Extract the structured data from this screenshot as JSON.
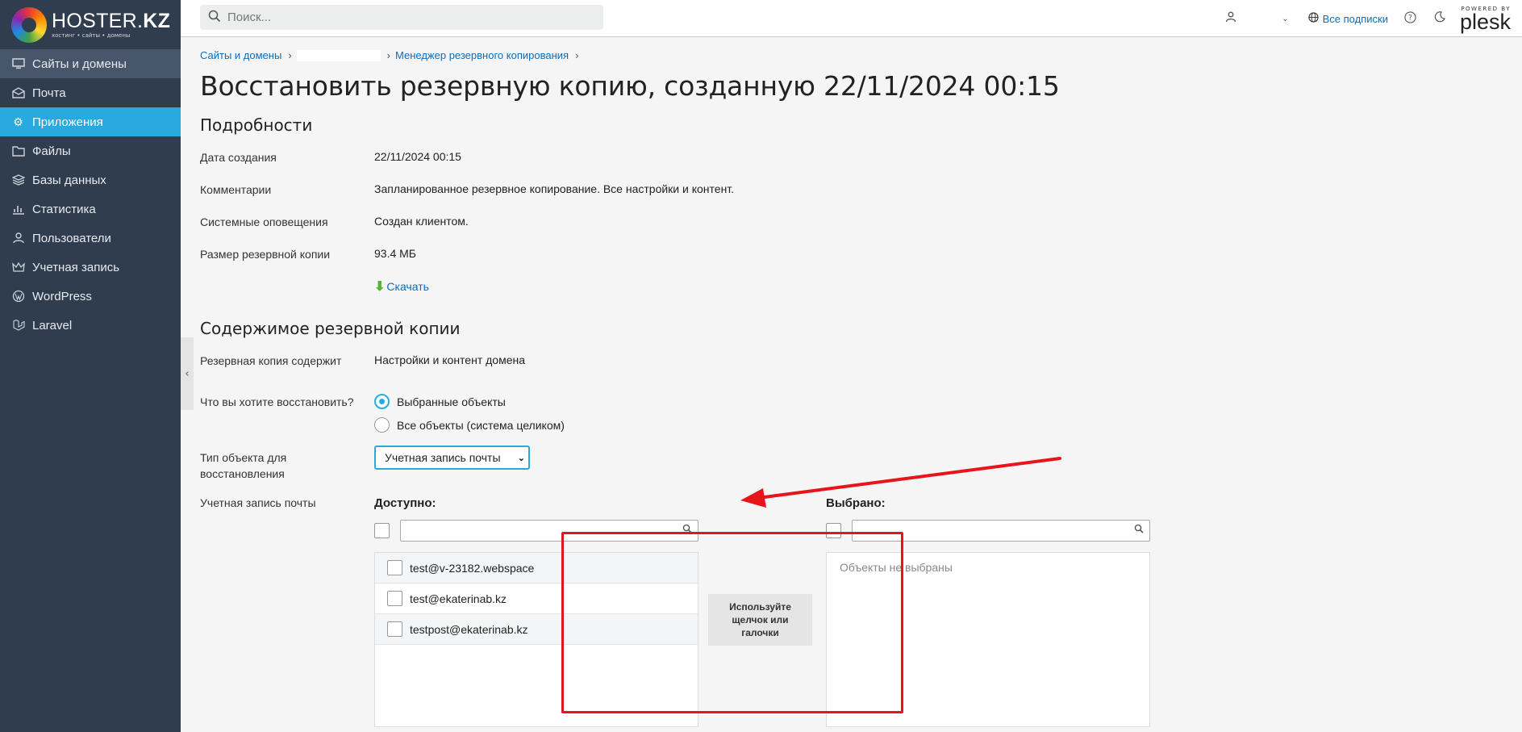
{
  "sidebar": {
    "logo": {
      "title": "HOSTER.",
      "title_bold": "KZ",
      "tagline": "хостинг • сайты • домены"
    },
    "items": [
      {
        "label": "Сайты и домены",
        "icon": "monitor-icon"
      },
      {
        "label": "Почта",
        "icon": "mail-icon"
      },
      {
        "label": "Приложения",
        "icon": "gear-icon"
      },
      {
        "label": "Файлы",
        "icon": "folder-icon"
      },
      {
        "label": "Базы данных",
        "icon": "database-icon"
      },
      {
        "label": "Статистика",
        "icon": "chart-icon"
      },
      {
        "label": "Пользователи",
        "icon": "user-icon"
      },
      {
        "label": "Учетная запись",
        "icon": "crown-icon"
      },
      {
        "label": "WordPress",
        "icon": "wordpress-icon"
      },
      {
        "label": "Laravel",
        "icon": "laravel-icon"
      }
    ]
  },
  "topbar": {
    "search_placeholder": "Поиск...",
    "subscriptions": "Все подписки",
    "powered_by": "POWERED BY",
    "brand": "plesk"
  },
  "breadcrumb": {
    "items": [
      "Сайты и домены",
      "Менеджер резервного копирования"
    ]
  },
  "page": {
    "title": "Восстановить резервную копию, созданную 22/11/2024 00:15"
  },
  "details": {
    "heading": "Подробности",
    "rows": [
      {
        "label": "Дата создания",
        "value": "22/11/2024 00:15"
      },
      {
        "label": "Комментарии",
        "value": "Запланированное резервное копирование. Все настройки и контент."
      },
      {
        "label": "Системные оповещения",
        "value": "Создан клиентом."
      },
      {
        "label": "Размер резервной копии",
        "value": "93.4 МБ"
      }
    ],
    "download": "Скачать"
  },
  "content": {
    "heading": "Содержимое резервной копии",
    "contains_label": "Резервная копия содержит",
    "contains_value": "Настройки и контент домена",
    "restore_label": "Что вы хотите восстановить?",
    "options": [
      {
        "label": "Выбранные объекты",
        "selected": true
      },
      {
        "label": "Все объекты (система целиком)",
        "selected": false
      }
    ],
    "type_label_1": "Тип объекта для",
    "type_label_2": "восстановления",
    "type_value": "Учетная запись почты",
    "mail_label": "Учетная запись почты"
  },
  "picker": {
    "available_label": "Доступно:",
    "selected_label": "Выбрано:",
    "available_items": [
      "test@v-23182.webspace",
      "test@ekaterinab.kz",
      "testpost@ekaterinab.kz"
    ],
    "empty_text": "Объекты не выбраны",
    "hint": "Используйте щелчок или галочки"
  },
  "colors": {
    "sidebar": "#303d4e",
    "accent": "#28aade",
    "link": "#0a6ebd",
    "annotation": "#e8141c"
  }
}
